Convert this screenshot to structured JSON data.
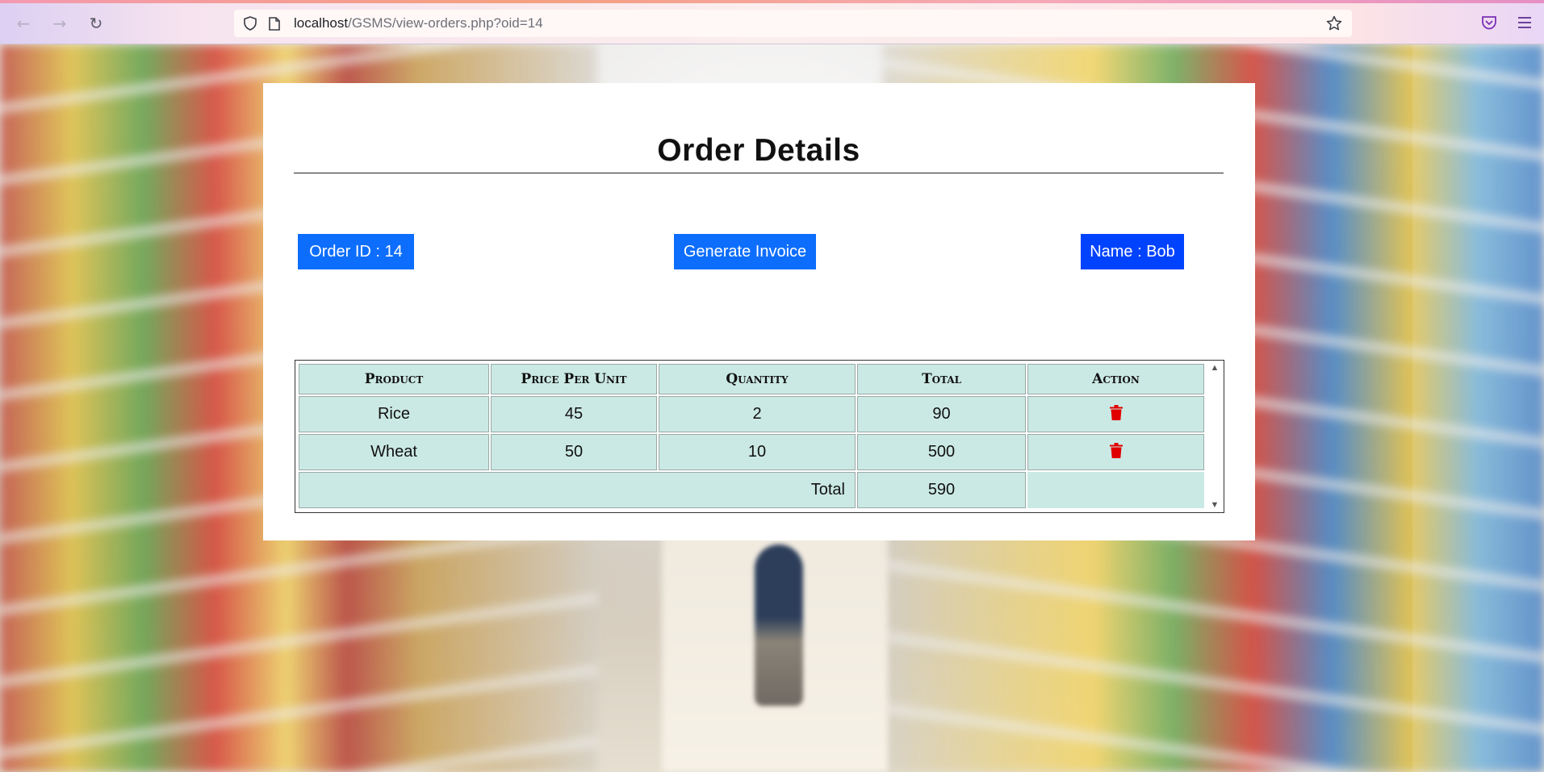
{
  "browser": {
    "url_host": "localhost",
    "url_path": "/GSMS/view-orders.php?oid=14"
  },
  "page": {
    "title": "Order Details",
    "order_id_label": "Order ID : 14",
    "generate_invoice_label": "Generate Invoice",
    "customer_name_label": "Name : Bob"
  },
  "table": {
    "headers": [
      "Product",
      "Price Per Unit",
      "Quantity",
      "Total",
      "Action"
    ],
    "rows": [
      {
        "product": "Rice",
        "price": "45",
        "quantity": "2",
        "total": "90",
        "action": "trash-icon"
      },
      {
        "product": "Wheat",
        "price": "50",
        "quantity": "10",
        "total": "500",
        "action": "trash-icon"
      }
    ],
    "total_label": "Total",
    "grand_total": "590"
  },
  "colors": {
    "button_blue": "#0d6efd",
    "name_blue": "#0043ff",
    "table_cell": "#cbe9e4",
    "delete_red": "#e00000"
  }
}
